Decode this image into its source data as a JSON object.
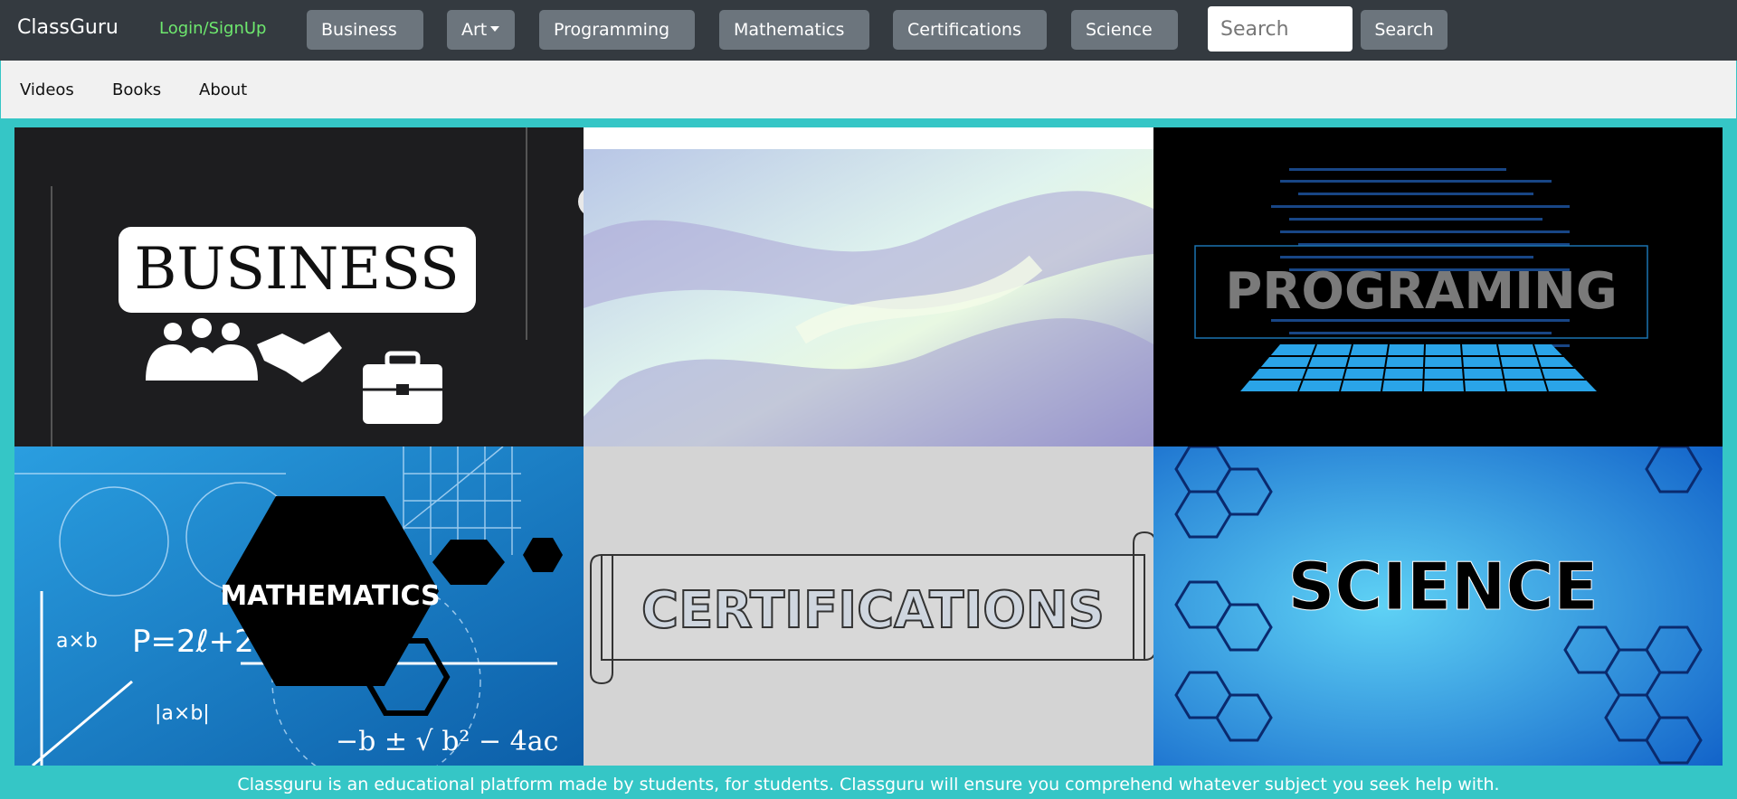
{
  "brand": "ClassGuru",
  "login_label": "Login/SignUp",
  "nav": {
    "dropdowns": [
      "Business",
      "Art",
      "Programming",
      "Mathematics",
      "Certifications",
      "Science"
    ],
    "search_placeholder": "Search",
    "search_button": "Search"
  },
  "subnav": [
    "Videos",
    "Books",
    "About"
  ],
  "tiles": {
    "business": "BUSINESS",
    "programming": "PROGRAMING",
    "mathematics": "MATHEMATICS",
    "certifications": "CERTIFICATIONS",
    "science": "SCIENCE",
    "math_formula_1": "P=2ℓ+2w",
    "math_formula_2": "−b ± √ b² − 4ac",
    "math_formula_3": "a×b",
    "math_formula_4": "|a×b|"
  },
  "footer": "Classguru is an educational platform made by students, for students. Classguru will ensure you comprehend whatever subject you seek help with.",
  "colors": {
    "navbar": "#343a40",
    "button": "#6c757d",
    "login": "#6ee86e",
    "frame": "#35c6c6",
    "subnav": "#f1f1f1"
  }
}
